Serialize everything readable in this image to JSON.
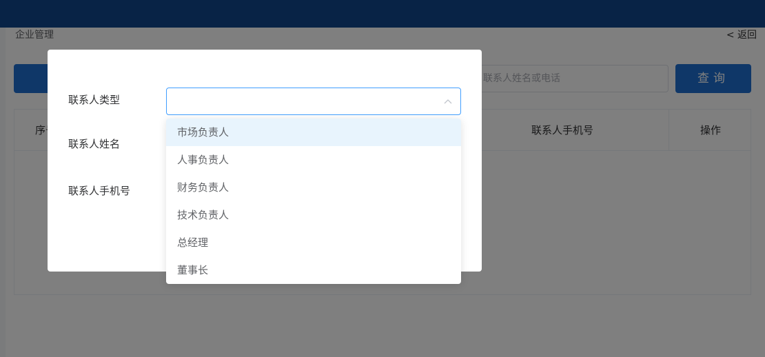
{
  "page": {
    "breadcrumb": "企业管理",
    "back": "< 返回",
    "search": {
      "placeholder": "联系人姓名或电话"
    },
    "query_button": "查询",
    "table": {
      "index_header": "序号",
      "phone_header": "联系人手机号",
      "ops_header": "操作"
    }
  },
  "dialog": {
    "labels": {
      "type": "联系人类型",
      "name": "联系人姓名",
      "phone": "联系人手机号"
    },
    "type_select": {
      "value": ""
    },
    "dropdown_options": [
      "市场负责人",
      "人事负责人",
      "财务负责人",
      "技术负责人",
      "总经理",
      "董事长"
    ],
    "highlighted_option": "市场负责人"
  },
  "colors": {
    "topbar": "#10478c",
    "primary": "#1e6fd0",
    "focus_border": "#409eff",
    "hover_option": "#e8f4fd"
  },
  "icons": {
    "select_arrow": "chevron-up-icon"
  }
}
